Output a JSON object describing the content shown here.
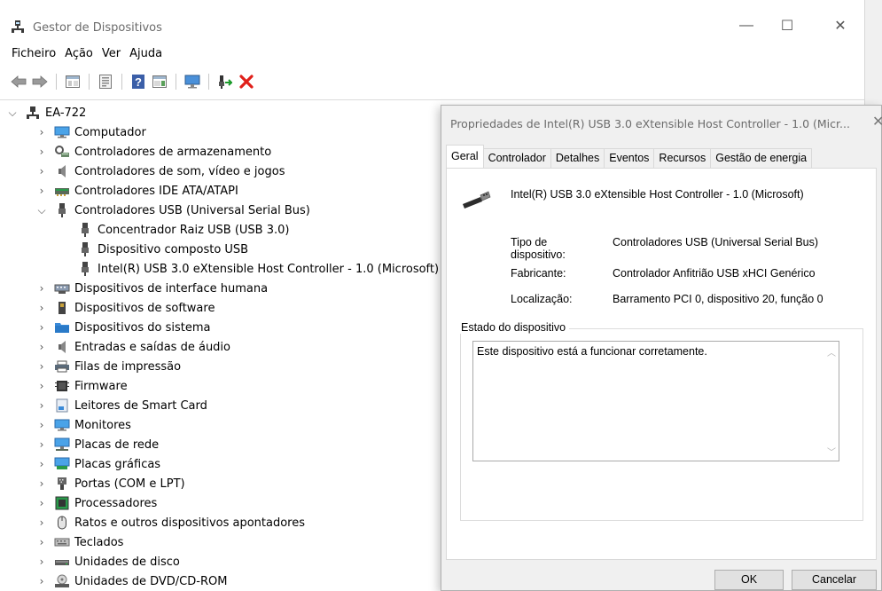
{
  "app": {
    "title": "Gestor de Dispositivos",
    "minimize_glyph": "—",
    "maximize_glyph": "☐",
    "close_glyph": "✕"
  },
  "menu": [
    "Ficheiro",
    "Ação",
    "Ver",
    "Ajuda"
  ],
  "toolbar": {
    "icons": [
      "back-arrow-icon",
      "forward-arrow-icon",
      "show-hide-tree-icon",
      "properties-icon",
      "help-icon",
      "action-pane-icon",
      "monitor-icon",
      "enable-device-icon",
      "uninstall-device-icon"
    ]
  },
  "tree": {
    "root": "EA-722",
    "categories": [
      {
        "label": "Computador",
        "icon": "computer-icon"
      },
      {
        "label": "Controladores de armazenamento",
        "icon": "storage-controller-icon"
      },
      {
        "label": "Controladores de som, vídeo e jogos",
        "icon": "speaker-icon"
      },
      {
        "label": "Controladores IDE ATA/ATAPI",
        "icon": "ide-controller-icon"
      },
      {
        "label": "Controladores USB (Universal Serial Bus)",
        "icon": "usb-icon",
        "expanded": true,
        "children": [
          "Concentrador Raiz USB (USB 3.0)",
          "Dispositivo composto USB",
          "Intel(R) USB 3.0 eXtensible Host Controller - 1.0 (Microsoft)"
        ]
      },
      {
        "label": "Dispositivos de interface humana",
        "icon": "hid-icon"
      },
      {
        "label": "Dispositivos de software",
        "icon": "software-device-icon"
      },
      {
        "label": "Dispositivos do sistema",
        "icon": "system-folder-icon"
      },
      {
        "label": "Entradas e saídas de áudio",
        "icon": "audio-io-icon"
      },
      {
        "label": "Filas de impressão",
        "icon": "printer-icon"
      },
      {
        "label": "Firmware",
        "icon": "firmware-icon"
      },
      {
        "label": "Leitores de Smart Card",
        "icon": "smart-card-icon"
      },
      {
        "label": "Monitores",
        "icon": "monitor-icon"
      },
      {
        "label": "Placas de rede",
        "icon": "network-adapter-icon"
      },
      {
        "label": "Placas gráficas",
        "icon": "display-adapter-icon"
      },
      {
        "label": "Portas (COM e LPT)",
        "icon": "port-icon"
      },
      {
        "label": "Processadores",
        "icon": "processor-icon"
      },
      {
        "label": "Ratos e outros dispositivos apontadores",
        "icon": "mouse-icon"
      },
      {
        "label": "Teclados",
        "icon": "keyboard-icon"
      },
      {
        "label": "Unidades de disco",
        "icon": "disk-drive-icon"
      },
      {
        "label": "Unidades de DVD/CD-ROM",
        "icon": "dvd-drive-icon"
      }
    ]
  },
  "dialog": {
    "title": "Propriedades de Intel(R) USB 3.0 eXtensible Host Controller - 1.0 (Micr...",
    "close_glyph": "✕",
    "tabs": [
      "Geral",
      "Controlador",
      "Detalhes",
      "Eventos",
      "Recursos",
      "Gestão de energia"
    ],
    "active_tab": "Geral",
    "device_name": "Intel(R) USB 3.0 eXtensible Host Controller - 1.0 (Microsoft)",
    "props": {
      "type_label": "Tipo de dispositivo:",
      "type_value": "Controladores USB (Universal Serial Bus)",
      "manufacturer_label": "Fabricante:",
      "manufacturer_value": "Controlador Anfitrião USB xHCI Genérico",
      "location_label": "Localização:",
      "location_value": "Barramento PCI 0, dispositivo 20, função 0"
    },
    "status_group_label": "Estado do dispositivo",
    "status_text": "Este dispositivo está a funcionar corretamente.",
    "ok_label": "OK",
    "cancel_label": "Cancelar"
  },
  "colors": {
    "title_text": "#6b6b6b",
    "dialog_bg": "#f0f0f0",
    "uninstall_red": "#e0201a",
    "enable_green": "#1a9a2a"
  }
}
